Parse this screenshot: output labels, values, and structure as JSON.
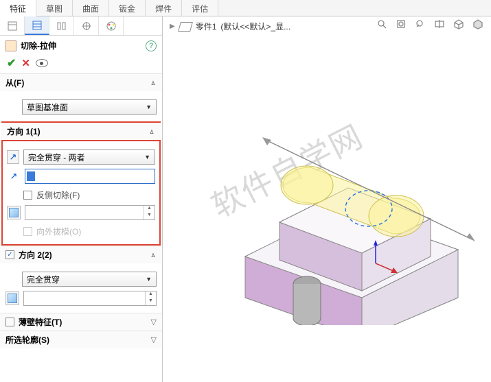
{
  "tabs": {
    "items": [
      "特征",
      "草图",
      "曲面",
      "钣金",
      "焊件",
      "评估"
    ],
    "active": 0
  },
  "breadcrumb": {
    "part": "零件1",
    "trail": "(默认<<默认>_显..."
  },
  "feature": {
    "title": "切除-拉伸"
  },
  "from": {
    "head": "从(F)",
    "plane": "草图基准面"
  },
  "dir1": {
    "head": "方向 1(1)",
    "condition": "完全贯穿 - 两者",
    "reverse_label": "反侧切除(F)",
    "draft_outward_label": "向外拔模(O)"
  },
  "dir2": {
    "head": "方向 2(2)",
    "condition": "完全贯穿",
    "enabled": true
  },
  "thin": {
    "head": "薄壁特征(T)",
    "enabled": false
  },
  "contours": {
    "head": "所选轮廓(S)"
  },
  "watermark": "软件自学网"
}
